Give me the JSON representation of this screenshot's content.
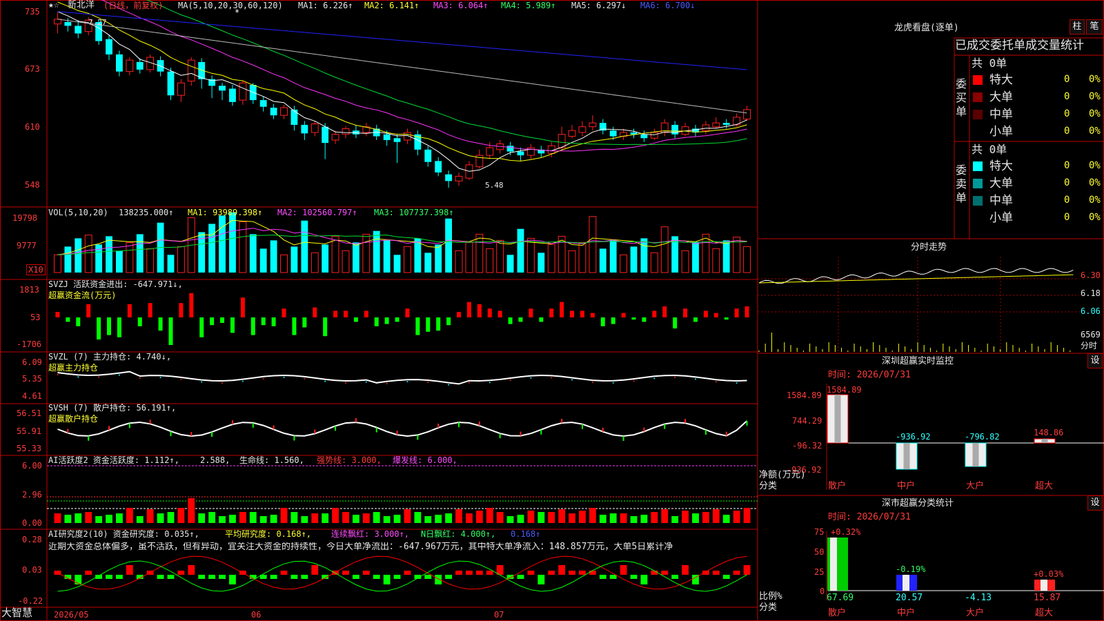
{
  "stock": {
    "name": "新北洋",
    "period": "(日线，前复权)",
    "ma_label": "MA(5,10,20,30,60,120)",
    "ma1": "MA1: 6.226↑",
    "ma2": "MA2: 6.141↑",
    "ma3": "MA3: 6.064↑",
    "ma4": "MA4: 5.989↑",
    "ma5": "MA5: 6.297↓",
    "ma6": "MA6: 6.700↓",
    "high_label": "7.27",
    "low_label": "5.48",
    "yticks": [
      "735",
      "673",
      "610",
      "548"
    ]
  },
  "vol": {
    "label": "VOL(5,10,20)",
    "value": "138235.000↑",
    "ma1": "MA1: 93989.398↑",
    "ma2": "MA2: 102560.797↑",
    "ma3": "MA3: 107737.398↑",
    "yticks": [
      "19798",
      "9777"
    ],
    "unit": "X10"
  },
  "svzj": {
    "label": "SVZJ  活跃资金进出: -647.971↓,",
    "sub": "超赢资金流(万元)",
    "yticks": [
      "1813",
      "53",
      "-1706"
    ]
  },
  "svzl": {
    "label": "SVZL (7) 主力持仓: 4.740↓,",
    "sub": "超赢主力持仓",
    "yticks": [
      "6.09",
      "5.35",
      "4.61"
    ]
  },
  "svsh": {
    "label": "SVSH (7) 散户持仓: 56.191↑,",
    "sub": "超赢散户持仓",
    "yticks": [
      "56.51",
      "55.91",
      "55.33"
    ]
  },
  "ai1": {
    "label": "AI活跃度2 资金活跃度: 1.112↑,",
    "v2": "2.588,",
    "v3": "生命线: 1.560,",
    "v4": "强势线: 3.000,",
    "v5": "爆发线: 6.000,",
    "yticks": [
      "6.00",
      "2.96",
      "0.00"
    ]
  },
  "ai2": {
    "label": "AI研究度2(10) 资金研究度: 0.035↑,",
    "v2": "平均研究度: 0.168↑,",
    "v3": "连续飘红: 3.000↑,",
    "v4": "N日飘红: 4.000↑,",
    "v5": "0.168↑",
    "comment": "近期大资金总体偏多，虽不活跃，但有异动，宜关注大资金的持续性，今日大单净流出：-647.967万元，其中特大单净流入：148.857万元，大单5日累计净",
    "yticks": [
      "0.28",
      "0.03",
      "-0.22"
    ]
  },
  "xaxis": {
    "brand": "大智慧",
    "labels": [
      "2026/05",
      "06",
      "07"
    ]
  },
  "lhb": {
    "title": "龙虎看盘(逐单)",
    "btn1": "柱",
    "btn2": "笔",
    "subtitle": "已成交委托单成交量统计",
    "buy": {
      "side": "委买单",
      "total": "共 0单",
      "rows": [
        {
          "name": "特大",
          "count": "0",
          "pct": "0%",
          "color": "#ff0000"
        },
        {
          "name": "大单",
          "count": "0",
          "pct": "0%",
          "color": "#8b0000"
        },
        {
          "name": "中单",
          "count": "0",
          "pct": "0%",
          "color": "#5a0000"
        },
        {
          "name": "小单",
          "count": "0",
          "pct": "0%",
          "color": ""
        }
      ]
    },
    "sell": {
      "side": "委卖单",
      "total": "共 0单",
      "rows": [
        {
          "name": "特大",
          "count": "0",
          "pct": "0%",
          "color": "#00ffff"
        },
        {
          "name": "大单",
          "count": "0",
          "pct": "0%",
          "color": "#009999"
        },
        {
          "name": "中单",
          "count": "0",
          "pct": "0%",
          "color": "#006f6f"
        },
        {
          "name": "小单",
          "count": "0",
          "pct": "0%",
          "color": ""
        }
      ]
    }
  },
  "intraday": {
    "title": "分时走势",
    "yticks": [
      "6.30",
      "6.18",
      "6.06"
    ],
    "vol_label": "6569",
    "vol_unit": "分时"
  },
  "sz_monitor": {
    "title": "深圳超赢实时监控",
    "btn": "设",
    "time": "时间: 2026/07/31",
    "yticks": [
      "1584.89",
      "744.29",
      "-96.32",
      "-936.92"
    ],
    "axis_title": "净额(万元)",
    "axis_title2": "分类",
    "categories": [
      "散户",
      "中户",
      "大户",
      "超大"
    ],
    "values": [
      "1584.89",
      "-936.92",
      "-796.82",
      "148.86"
    ]
  },
  "sz_class": {
    "title": "深市超赢分类统计",
    "btn": "设",
    "time": "时间: 2026/07/31",
    "yticks": [
      "75",
      "50",
      "25",
      "0"
    ],
    "axis_title": "比例%",
    "axis_title2": "分类",
    "top_labels": [
      "+0.32%",
      "-0.19%",
      "+0.03%"
    ],
    "bottom_values": [
      "67.69",
      "20.57",
      "-4.13",
      "15.87"
    ],
    "categories": [
      "散户",
      "中户",
      "大户",
      "超大"
    ]
  },
  "chart_data": {
    "type": "candlestick",
    "title": "新北洋 (日线，前复权)",
    "y_range": [
      5.48,
      7.35
    ],
    "candles": [
      [
        7.2,
        7.25,
        7.32,
        7.1
      ],
      [
        7.22,
        7.18,
        7.26,
        7.12
      ],
      [
        7.18,
        7.1,
        7.24,
        7.05
      ],
      [
        7.12,
        7.24,
        7.27,
        7.08
      ],
      [
        7.22,
        7.02,
        7.24,
        6.98
      ],
      [
        7.04,
        6.88,
        7.08,
        6.82
      ],
      [
        6.88,
        6.7,
        6.92,
        6.65
      ],
      [
        6.7,
        6.82,
        6.85,
        6.66
      ],
      [
        6.8,
        6.72,
        6.84,
        6.68
      ],
      [
        6.72,
        6.85,
        6.88,
        6.69
      ],
      [
        6.82,
        6.7,
        6.86,
        6.65
      ],
      [
        6.7,
        6.45,
        6.74,
        6.4
      ],
      [
        6.45,
        6.58,
        6.62,
        6.38
      ],
      [
        6.6,
        6.82,
        6.85,
        6.55
      ],
      [
        6.8,
        6.62,
        6.84,
        6.52
      ],
      [
        6.62,
        6.55,
        6.66,
        6.42
      ],
      [
        6.55,
        6.5,
        6.58,
        6.4
      ],
      [
        6.52,
        6.38,
        6.56,
        6.34
      ],
      [
        6.4,
        6.58,
        6.6,
        6.35
      ],
      [
        6.56,
        6.4,
        6.58,
        6.36
      ],
      [
        6.4,
        6.33,
        6.44,
        6.28
      ],
      [
        6.32,
        6.24,
        6.36,
        6.2
      ],
      [
        6.24,
        6.32,
        6.35,
        6.2
      ],
      [
        6.3,
        6.14,
        6.34,
        6.08
      ],
      [
        6.14,
        6.05,
        6.18,
        5.98
      ],
      [
        6.06,
        6.15,
        6.18,
        6.02
      ],
      [
        6.12,
        5.95,
        6.16,
        5.78
      ],
      [
        5.98,
        6.04,
        6.08,
        5.94
      ],
      [
        6.04,
        6.1,
        6.13,
        6.0
      ],
      [
        6.08,
        6.04,
        6.14,
        6.0
      ],
      [
        6.06,
        6.12,
        6.16,
        6.02
      ],
      [
        6.1,
        6.02,
        6.14,
        5.98
      ],
      [
        6.04,
        5.98,
        6.08,
        5.92
      ],
      [
        6.0,
        5.96,
        6.04,
        5.74
      ],
      [
        5.98,
        6.06,
        6.1,
        5.94
      ],
      [
        6.04,
        5.88,
        6.08,
        5.82
      ],
      [
        5.88,
        5.75,
        5.92,
        5.7
      ],
      [
        5.76,
        5.64,
        5.8,
        5.6
      ],
      [
        5.62,
        5.55,
        5.66,
        5.48
      ],
      [
        5.55,
        5.6,
        5.64,
        5.5
      ],
      [
        5.58,
        5.72,
        5.76,
        5.56
      ],
      [
        5.7,
        5.82,
        5.88,
        5.68
      ],
      [
        5.82,
        5.9,
        5.96,
        5.78
      ],
      [
        5.88,
        5.94,
        5.98,
        5.84
      ],
      [
        5.92,
        5.86,
        5.96,
        5.82
      ],
      [
        5.86,
        5.82,
        5.9,
        5.76
      ],
      [
        5.82,
        5.9,
        5.94,
        5.78
      ],
      [
        5.88,
        5.84,
        5.92,
        5.8
      ],
      [
        5.84,
        5.92,
        5.96,
        5.8
      ],
      [
        5.9,
        6.04,
        6.12,
        5.88
      ],
      [
        6.02,
        6.08,
        6.14,
        6.0
      ],
      [
        6.06,
        6.12,
        6.18,
        6.02
      ],
      [
        6.12,
        6.16,
        6.24,
        6.08
      ],
      [
        6.16,
        6.08,
        6.2,
        6.04
      ],
      [
        6.08,
        6.02,
        6.12,
        5.98
      ],
      [
        6.02,
        6.06,
        6.1,
        5.98
      ],
      [
        6.06,
        6.04,
        6.1,
        6.0
      ],
      [
        6.04,
        6.0,
        6.08,
        5.96
      ],
      [
        6.0,
        6.06,
        6.1,
        5.98
      ],
      [
        6.06,
        6.16,
        6.2,
        6.02
      ],
      [
        6.14,
        6.04,
        6.18,
        6.0
      ],
      [
        6.04,
        6.12,
        6.16,
        6.02
      ],
      [
        6.1,
        6.06,
        6.14,
        6.02
      ],
      [
        6.08,
        6.14,
        6.18,
        6.04
      ],
      [
        6.12,
        6.16,
        6.22,
        6.1
      ],
      [
        6.16,
        6.14,
        6.2,
        6.1
      ],
      [
        6.14,
        6.22,
        6.26,
        6.12
      ],
      [
        6.2,
        6.3,
        6.34,
        6.18
      ]
    ]
  }
}
